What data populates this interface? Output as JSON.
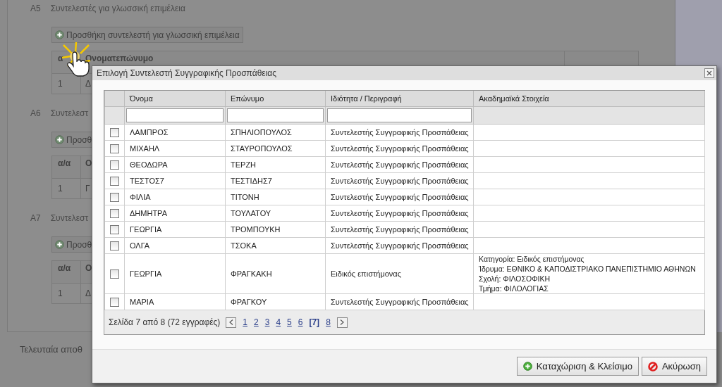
{
  "background_page": {
    "sections": [
      {
        "code": "A5",
        "title": "Συντελεστές για γλωσσική επιμέλεια",
        "add_button": "Προσθήκη συντελεστή για γλωσσική επιμέλεια",
        "table": {
          "columns": [
            "α",
            "Ονοματεπώνυμο"
          ],
          "rows": [
            [
              "1",
              "Δ"
            ]
          ]
        }
      },
      {
        "code": "A6",
        "title": "Συντελεστ",
        "add_button": "Προσθ",
        "table": {
          "columns": [
            "α/α",
            "Ο"
          ],
          "rows": [
            [
              "1",
              "Γ"
            ]
          ]
        }
      },
      {
        "code": "A7",
        "title": "Συντελεστ",
        "add_button": "Προσθ",
        "table": {
          "columns": [
            "α/α",
            "Ο"
          ],
          "rows": [
            [
              "1",
              "Δ"
            ]
          ]
        }
      }
    ],
    "footer_text": "Τελευταία αποθ"
  },
  "dialog": {
    "title": "Επιλογή Συντελεστή Συγγραφικής Προσπάθειας",
    "table": {
      "columns": [
        {
          "label": "Όνομα",
          "filter": true
        },
        {
          "label": "Επώνυμο",
          "filter": true
        },
        {
          "label": "Ιδιότητα / Περιγραφή",
          "filter": true
        },
        {
          "label": "Ακαδημαϊκά Στοιχεία",
          "filter": false
        }
      ],
      "rows": [
        {
          "checked": false,
          "name": "ΛΑΜΠΡΟΣ",
          "surname": "ΣΠΗΛΙΟΠΟΥΛΟΣ",
          "role": "Συντελεστής Συγγραφικής Προσπάθειας"
        },
        {
          "checked": false,
          "name": "ΜΙΧΑΗΛ",
          "surname": "ΣΤΑΥΡΟΠΟΥΛΟΣ",
          "role": "Συντελεστής Συγγραφικής Προσπάθειας"
        },
        {
          "checked": false,
          "name": "ΘΕΟΔΩΡΑ",
          "surname": "ΤΕΡΖΗ",
          "role": "Συντελεστής Συγγραφικής Προσπάθειας"
        },
        {
          "checked": false,
          "name": "ΤΕΣΤΟΣ7",
          "surname": "ΤΕΣΤΙΔΗΣ7",
          "role": "Συντελεστής Συγγραφικής Προσπάθειας"
        },
        {
          "checked": false,
          "name": "ΦΙΛΙΑ",
          "surname": "ΤΙΤΟΝΗ",
          "role": "Συντελεστής Συγγραφικής Προσπάθειας"
        },
        {
          "checked": false,
          "name": "ΔΗΜΗΤΡΑ",
          "surname": "ΤΟΥΛΑΤΟΥ",
          "role": "Συντελεστής Συγγραφικής Προσπάθειας"
        },
        {
          "checked": false,
          "name": "ΓΕΩΡΓΙΑ",
          "surname": "ΤΡΟΜΠΟΥΚΗ",
          "role": "Συντελεστής Συγγραφικής Προσπάθειας"
        },
        {
          "checked": false,
          "name": "ΟΛΓΑ",
          "surname": "ΤΣΟΚΑ",
          "role": "Συντελεστής Συγγραφικής Προσπάθειας"
        },
        {
          "checked": false,
          "name": "ΓΕΩΡΓΙΑ",
          "surname": "ΦΡΑΓΚΑΚΗ",
          "role": "Ειδικός επιστήμονας",
          "academic": [
            "Κατηγορία: Ειδικός επιστήμονας",
            "Ίδρυμα: ΕΘΝΙΚΟ & ΚΑΠΟΔΙΣΤΡΙΑΚΟ ΠΑΝΕΠΙΣΤΗΜΙΟ ΑΘΗΝΩΝ",
            "Σχολή: ΦΙΛΟΣΟΦΙΚΗ",
            "Τμήμα: ΦΙΛΟΛΟΓΙΑΣ"
          ]
        },
        {
          "checked": false,
          "name": "ΜΑΡΙΑ",
          "surname": "ΦΡΑΓΚΟΥ",
          "role": "Συντελεστής Συγγραφικής Προσπάθειας"
        }
      ]
    },
    "pager": {
      "summary": "Σελίδα 7 από 8 (72 εγγραφές)",
      "pages": [
        {
          "label": "1",
          "selected": false
        },
        {
          "label": "2",
          "selected": false
        },
        {
          "label": "3",
          "selected": false
        },
        {
          "label": "4",
          "selected": false
        },
        {
          "label": "5",
          "selected": false
        },
        {
          "label": "6",
          "selected": false
        },
        {
          "label": "[7]",
          "selected": true
        },
        {
          "label": "8",
          "selected": false
        }
      ]
    },
    "buttons": [
      {
        "kind": "confirm",
        "label": "Καταχώριση & Κλείσιμο"
      },
      {
        "kind": "cancel",
        "label": "Ακύρωση"
      }
    ]
  }
}
